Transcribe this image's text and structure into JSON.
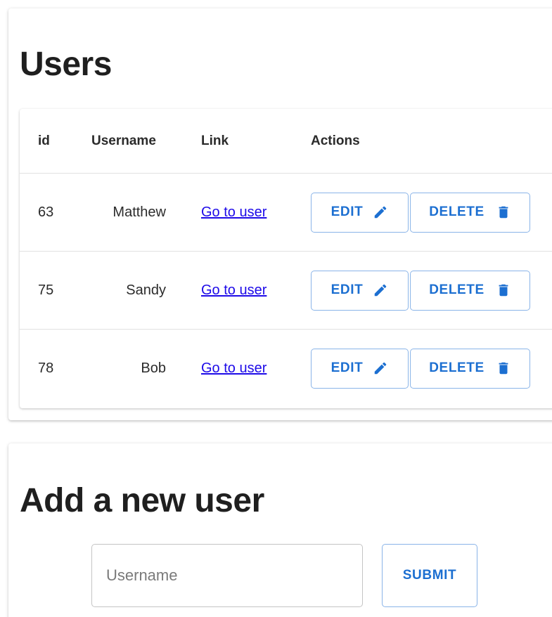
{
  "users_section": {
    "title": "Users",
    "columns": {
      "id": "id",
      "username": "Username",
      "link": "Link",
      "actions": "Actions"
    },
    "rows": [
      {
        "id": "63",
        "username": "Matthew",
        "link": "Go to user",
        "edit": "EDIT",
        "delete": "DELETE"
      },
      {
        "id": "75",
        "username": "Sandy",
        "link": "Go to user",
        "edit": "EDIT",
        "delete": "DELETE"
      },
      {
        "id": "78",
        "username": "Bob",
        "link": "Go to user",
        "edit": "EDIT",
        "delete": "DELETE"
      }
    ]
  },
  "add_section": {
    "title": "Add a new user",
    "username_placeholder": "Username",
    "username_value": "",
    "submit_label": "SUBMIT"
  },
  "icons": {
    "edit": "pencil-icon",
    "delete": "trash-icon"
  },
  "colors": {
    "primary": "#1c6fd1",
    "button_border": "#8ab4e8",
    "link": "#1d0ae8"
  }
}
